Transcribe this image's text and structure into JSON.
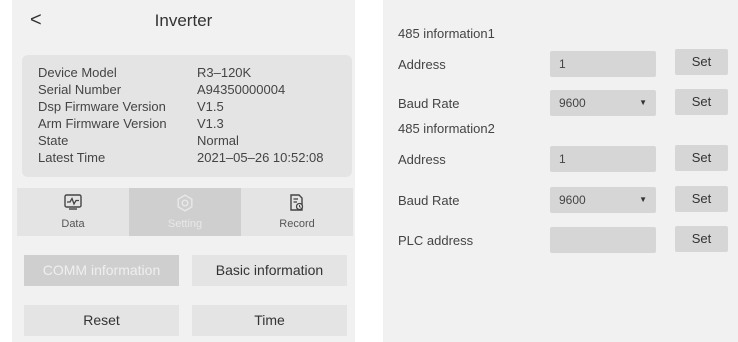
{
  "left": {
    "header": {
      "back_icon": "chevron-left-icon",
      "back_glyph": "<",
      "title": "Inverter"
    },
    "info": [
      {
        "label": "Device Model",
        "value": "R3–120K"
      },
      {
        "label": "Serial Number",
        "value": "A94350000004"
      },
      {
        "label": "Dsp Firmware Version",
        "value": "V1.5"
      },
      {
        "label": "Arm Firmware Version",
        "value": "V1.3"
      },
      {
        "label": "State",
        "value": "Normal"
      },
      {
        "label": "Latest Time",
        "value": "2021–05–26 10:52:08"
      }
    ],
    "tabs": [
      {
        "label": "Data",
        "icon": "chart-icon",
        "active": false
      },
      {
        "label": "Setting",
        "icon": "gear-icon",
        "active": true
      },
      {
        "label": "Record",
        "icon": "record-icon",
        "active": false
      }
    ],
    "buttons": {
      "comm": "COMM information",
      "basic": "Basic information",
      "reset": "Reset",
      "time": "Time"
    }
  },
  "right": {
    "section1": "485 information1",
    "section2": "485 information2",
    "address_label": "Address",
    "baud_label": "Baud Rate",
    "plc_label": "PLC address",
    "set_label": "Set",
    "addr1_value": "1",
    "baud1_value": "9600",
    "addr2_value": "1",
    "baud2_value": "9600",
    "plc_value": "",
    "caret_glyph": "▼"
  }
}
